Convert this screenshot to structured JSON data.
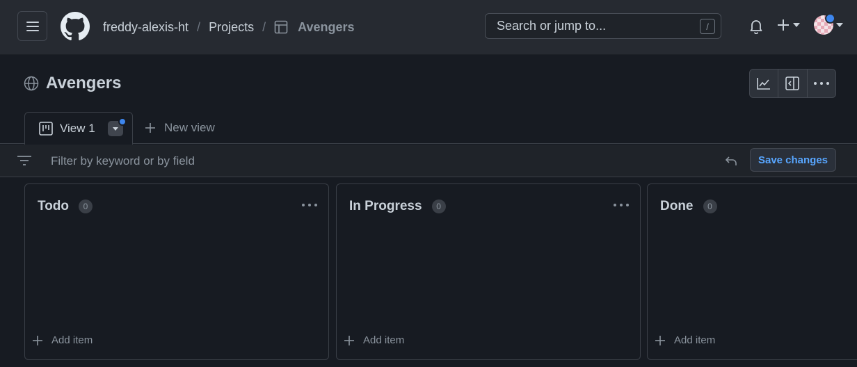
{
  "header": {
    "owner": "freddy-alexis-ht",
    "section": "Projects",
    "project": "Avengers",
    "search_placeholder": "Search or jump to...",
    "search_shortcut": "/"
  },
  "project": {
    "title": "Avengers"
  },
  "tabs": {
    "active_label": "View 1",
    "new_view_label": "New view"
  },
  "filter": {
    "placeholder": "Filter by keyword or by field",
    "save_label": "Save changes"
  },
  "columns": [
    {
      "title": "Todo",
      "count": "0",
      "add_label": "Add item"
    },
    {
      "title": "In Progress",
      "count": "0",
      "add_label": "Add item"
    },
    {
      "title": "Done",
      "count": "0",
      "add_label": "Add item"
    }
  ],
  "colors": {
    "accent": "#58a6ff",
    "notification_dot": "#3d86ee"
  }
}
